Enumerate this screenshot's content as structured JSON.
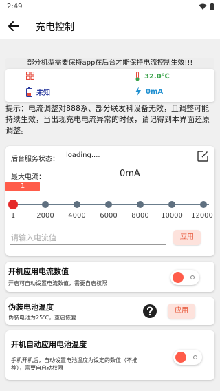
{
  "status_bar": {
    "time": "2:49"
  },
  "app_bar": {
    "title": "充电控制"
  },
  "notice": "部分机型需要保持app在后台才能保持电流控制生效!!!",
  "info": {
    "temperature": "32.0℃",
    "battery_status": "未知",
    "current": "0mA"
  },
  "tip": "提示：电流调整对888系、部分联发科设备无效，且调整可能持续生效，当出现充电电流异常的时候，请记得到本界面还原调整。",
  "service": {
    "status_label": "后台服务状态：",
    "status_value": "loading....",
    "max_current_label": "最大电流：",
    "max_current_value": "0mA",
    "slider_value": "1",
    "slider_ticks": [
      "1",
      "2000",
      "4000",
      "6000",
      "8000",
      "10000",
      "12000"
    ],
    "input_placeholder": "请输入电流值",
    "apply_label": "应用"
  },
  "settings": {
    "boot_current": {
      "title": "开机应用电流数值",
      "subtitle": "开启可自动设置电流数值，需要自启权限"
    },
    "fake_temp": {
      "title": "伪装电池温度",
      "subtitle": "伪装电池为25℃，重启恢复",
      "apply_label": "应用"
    },
    "boot_temp": {
      "title": "开机自动应用电池温度",
      "subtitle": "手机开机后，自动设置电池温度为设定的数值（不推荐），需要自启动权限"
    }
  },
  "colors": {
    "accent": "#ff5c4a",
    "thumb": "#e52a2a",
    "track": "#6b7d8c",
    "temp": "#3aa24a",
    "battery": "#2b3b9e",
    "current": "#1f8fd0"
  }
}
